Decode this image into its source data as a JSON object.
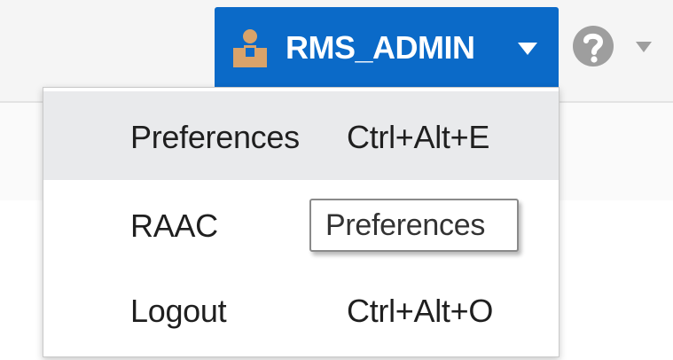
{
  "header": {
    "user_button": {
      "username": "RMS_ADMIN",
      "icon": "user-icon",
      "caret_icon": "chevron-down-icon",
      "background": "#0b6ac8"
    },
    "help": {
      "icon": "help-icon",
      "caret_icon": "chevron-down-icon"
    }
  },
  "user_menu": {
    "items": [
      {
        "label": "Preferences",
        "shortcut": "Ctrl+Alt+E",
        "highlighted": true
      },
      {
        "label": "RAAC",
        "shortcut": ""
      },
      {
        "label": "Logout",
        "shortcut": "Ctrl+Alt+O"
      }
    ]
  },
  "tooltip": {
    "text": "Preferences"
  }
}
